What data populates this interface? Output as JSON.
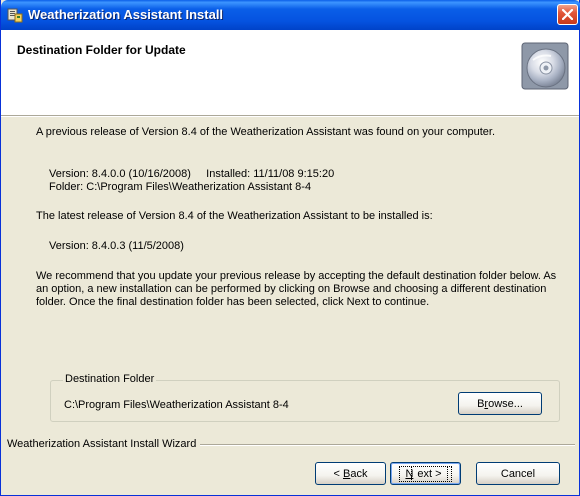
{
  "window": {
    "title": "Weatherization Assistant Install"
  },
  "header": {
    "title": "Destination Folder for Update"
  },
  "content": {
    "intro": "A previous release of Version 8.4 of the Weatherization Assistant was found on your computer.",
    "prev_version_line": "Version: 8.4.0.0 (10/16/2008)     Installed: 11/11/08 9:15:20",
    "prev_folder_line": "Folder: C:\\Program Files\\Weatherization Assistant 8-4",
    "latest_line": "The latest release of Version 8.4 of the Weatherization Assistant to be installed is:",
    "new_version_line": "Version: 8.4.0.3 (11/5/2008)",
    "recommendation": "We recommend that you update your previous release by accepting the default destination folder below.  As an option, a new installation can be performed by clicking on Browse and choosing a different destination folder.  Once the final destination folder has been selected, click Next to continue."
  },
  "destination": {
    "legend": "Destination Folder",
    "path": "C:\\Program Files\\Weatherization Assistant 8-4",
    "browse_label_prefix": "B",
    "browse_label_underlined": "r",
    "browse_label_suffix": "owse..."
  },
  "footer": {
    "wizard_label": "Weatherization Assistant Install Wizard",
    "back_label_prefix": "< ",
    "back_label_underlined": "B",
    "back_label_suffix": "ack",
    "next_label_underlined": "N",
    "next_label_suffix": "ext >",
    "cancel_label": "Cancel"
  },
  "icons": {
    "app": "installer-icon",
    "close": "close-icon",
    "cd": "cd-disc-icon"
  },
  "colors": {
    "titlebar": "#0A5FE8",
    "dialog_bg": "#ECE9D8",
    "close_button": "#E2563A"
  }
}
